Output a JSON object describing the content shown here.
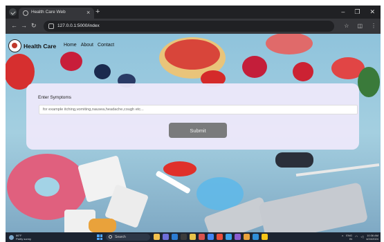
{
  "browser": {
    "tab_title": "Health Care Web",
    "new_tab_label": "+",
    "close_label": "×",
    "url": "127.0.0.1:5000/index",
    "window_controls": [
      "–",
      "❐",
      "✕"
    ]
  },
  "site": {
    "brand": "Health Care",
    "nav": [
      "Home",
      "About",
      "Contact"
    ]
  },
  "form": {
    "label": "Enter Symptoms",
    "placeholder": "for example itching,vomiting,nausea,headache,cough etc...",
    "submit": "Submit"
  },
  "taskbar": {
    "weather_temp": "86°F",
    "weather_desc": "Partly sunny",
    "search_label": "Search",
    "tray_lang": "ENG",
    "tray_region": "IN",
    "time": "10:36 AM",
    "date": "4/24/2024"
  },
  "colors": {
    "card": "#ece8fa",
    "submit_button": "#7a7b7c",
    "browser_chrome": "#202124"
  }
}
